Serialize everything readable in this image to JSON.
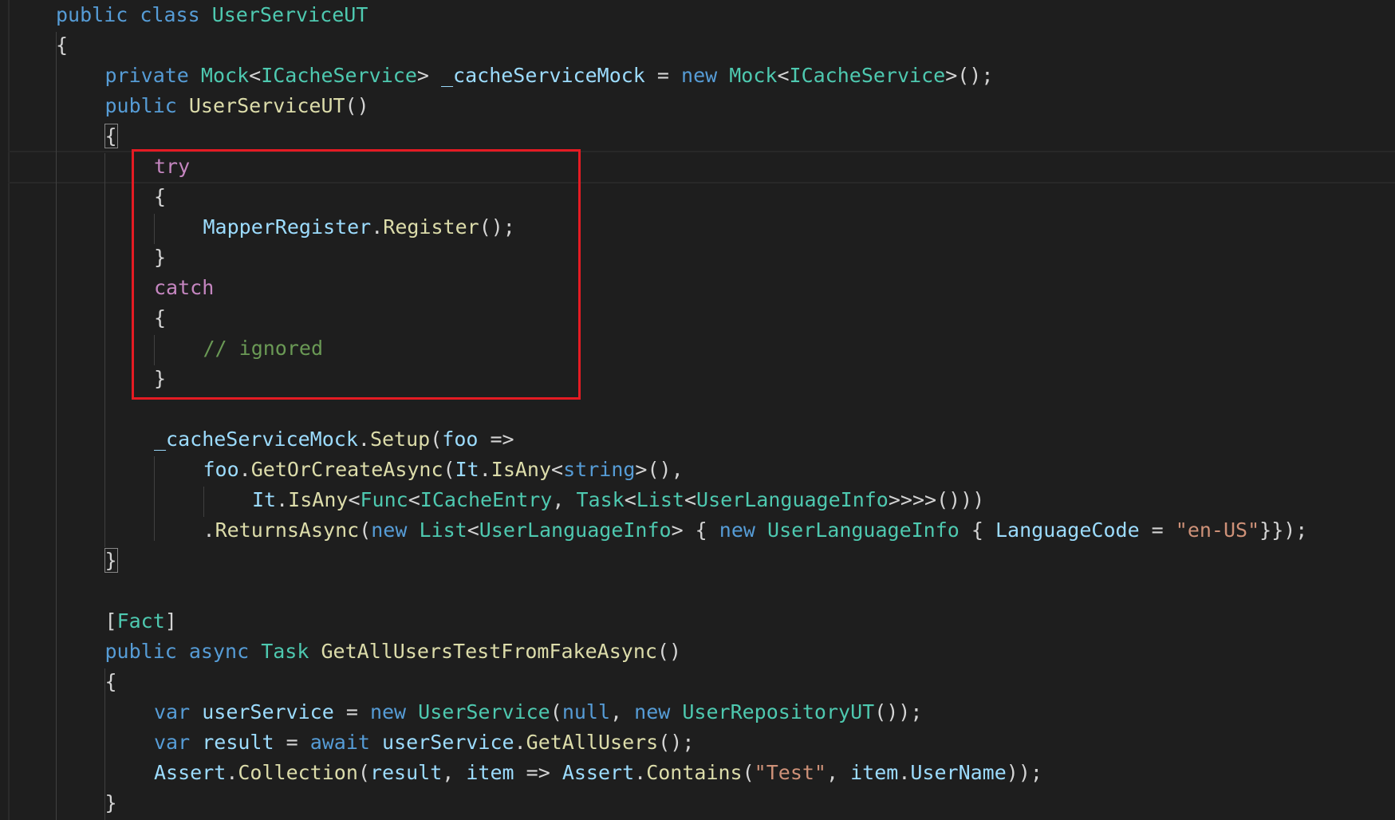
{
  "colors": {
    "background": "#1e1e1e",
    "keyword": "#569cd6",
    "control_keyword": "#c586c0",
    "type": "#4ec9b0",
    "method": "#dcdcaa",
    "identifier": "#9cdcfe",
    "string": "#ce9178",
    "comment": "#6a9955",
    "punctuation": "#d4d4d4",
    "highlight_box": "#e51b23"
  },
  "lines": [
    {
      "indent": 0,
      "tokens": [
        {
          "t": "public",
          "c": "kw"
        },
        {
          "t": " "
        },
        {
          "t": "class",
          "c": "kw"
        },
        {
          "t": " "
        },
        {
          "t": "UserServiceUT",
          "c": "type"
        }
      ]
    },
    {
      "indent": 0,
      "tokens": [
        {
          "t": "{"
        }
      ]
    },
    {
      "indent": 1,
      "tokens": [
        {
          "t": "private",
          "c": "kw"
        },
        {
          "t": " "
        },
        {
          "t": "Mock",
          "c": "type"
        },
        {
          "t": "<"
        },
        {
          "t": "ICacheService",
          "c": "type"
        },
        {
          "t": "> "
        },
        {
          "t": "_cacheServiceMock",
          "c": "id"
        },
        {
          "t": " = "
        },
        {
          "t": "new",
          "c": "kw"
        },
        {
          "t": " "
        },
        {
          "t": "Mock",
          "c": "type"
        },
        {
          "t": "<"
        },
        {
          "t": "ICacheService",
          "c": "type"
        },
        {
          "t": ">();"
        }
      ]
    },
    {
      "indent": 1,
      "tokens": [
        {
          "t": "public",
          "c": "kw"
        },
        {
          "t": " "
        },
        {
          "t": "UserServiceUT",
          "c": "fn"
        },
        {
          "t": "()"
        }
      ]
    },
    {
      "indent": 1,
      "tokens": [
        {
          "t": "{",
          "c": "bm"
        }
      ]
    },
    {
      "indent": 2,
      "tokens": [
        {
          "t": "try",
          "c": "ctl"
        }
      ]
    },
    {
      "indent": 2,
      "tokens": [
        {
          "t": "{"
        }
      ]
    },
    {
      "indent": 3,
      "tokens": [
        {
          "t": "MapperRegister",
          "c": "id"
        },
        {
          "t": "."
        },
        {
          "t": "Register",
          "c": "fn"
        },
        {
          "t": "();"
        }
      ]
    },
    {
      "indent": 2,
      "tokens": [
        {
          "t": "}"
        }
      ]
    },
    {
      "indent": 2,
      "tokens": [
        {
          "t": "catch",
          "c": "ctl"
        }
      ]
    },
    {
      "indent": 2,
      "tokens": [
        {
          "t": "{"
        }
      ]
    },
    {
      "indent": 3,
      "tokens": [
        {
          "t": "// ignored",
          "c": "cmt"
        }
      ]
    },
    {
      "indent": 2,
      "tokens": [
        {
          "t": "}"
        }
      ]
    },
    {
      "indent": 0,
      "tokens": []
    },
    {
      "indent": 2,
      "tokens": [
        {
          "t": "_cacheServiceMock",
          "c": "id"
        },
        {
          "t": "."
        },
        {
          "t": "Setup",
          "c": "fn"
        },
        {
          "t": "("
        },
        {
          "t": "foo",
          "c": "id"
        },
        {
          "t": " =>"
        }
      ]
    },
    {
      "indent": 3,
      "tokens": [
        {
          "t": "foo",
          "c": "id"
        },
        {
          "t": "."
        },
        {
          "t": "GetOrCreateAsync",
          "c": "fn"
        },
        {
          "t": "("
        },
        {
          "t": "It",
          "c": "id"
        },
        {
          "t": "."
        },
        {
          "t": "IsAny",
          "c": "fn"
        },
        {
          "t": "<"
        },
        {
          "t": "string",
          "c": "kw"
        },
        {
          "t": ">(),"
        }
      ]
    },
    {
      "indent": 4,
      "tokens": [
        {
          "t": "It",
          "c": "id"
        },
        {
          "t": "."
        },
        {
          "t": "IsAny",
          "c": "fn"
        },
        {
          "t": "<"
        },
        {
          "t": "Func",
          "c": "type"
        },
        {
          "t": "<"
        },
        {
          "t": "ICacheEntry",
          "c": "type"
        },
        {
          "t": ", "
        },
        {
          "t": "Task",
          "c": "type"
        },
        {
          "t": "<"
        },
        {
          "t": "List",
          "c": "type"
        },
        {
          "t": "<"
        },
        {
          "t": "UserLanguageInfo",
          "c": "type"
        },
        {
          "t": ">>>>()))"
        }
      ]
    },
    {
      "indent": 3,
      "tokens": [
        {
          "t": "."
        },
        {
          "t": "ReturnsAsync",
          "c": "fn"
        },
        {
          "t": "("
        },
        {
          "t": "new",
          "c": "kw"
        },
        {
          "t": " "
        },
        {
          "t": "List",
          "c": "type"
        },
        {
          "t": "<"
        },
        {
          "t": "UserLanguageInfo",
          "c": "type"
        },
        {
          "t": "> { "
        },
        {
          "t": "new",
          "c": "kw"
        },
        {
          "t": " "
        },
        {
          "t": "UserLanguageInfo",
          "c": "type"
        },
        {
          "t": " { "
        },
        {
          "t": "LanguageCode",
          "c": "id"
        },
        {
          "t": " = "
        },
        {
          "t": "\"en-US\"",
          "c": "str"
        },
        {
          "t": "}});"
        }
      ]
    },
    {
      "indent": 1,
      "tokens": [
        {
          "t": "}",
          "c": "bm"
        }
      ]
    },
    {
      "indent": 0,
      "tokens": []
    },
    {
      "indent": 1,
      "tokens": [
        {
          "t": "["
        },
        {
          "t": "Fact",
          "c": "type"
        },
        {
          "t": "]"
        }
      ]
    },
    {
      "indent": 1,
      "tokens": [
        {
          "t": "public",
          "c": "kw"
        },
        {
          "t": " "
        },
        {
          "t": "async",
          "c": "kw"
        },
        {
          "t": " "
        },
        {
          "t": "Task",
          "c": "type"
        },
        {
          "t": " "
        },
        {
          "t": "GetAllUsersTestFromFakeAsync",
          "c": "fn"
        },
        {
          "t": "()"
        }
      ]
    },
    {
      "indent": 1,
      "tokens": [
        {
          "t": "{"
        }
      ]
    },
    {
      "indent": 2,
      "tokens": [
        {
          "t": "var",
          "c": "kw"
        },
        {
          "t": " "
        },
        {
          "t": "userService",
          "c": "id"
        },
        {
          "t": " = "
        },
        {
          "t": "new",
          "c": "kw"
        },
        {
          "t": " "
        },
        {
          "t": "UserService",
          "c": "type"
        },
        {
          "t": "("
        },
        {
          "t": "null",
          "c": "kw"
        },
        {
          "t": ", "
        },
        {
          "t": "new",
          "c": "kw"
        },
        {
          "t": " "
        },
        {
          "t": "UserRepositoryUT",
          "c": "type"
        },
        {
          "t": "());"
        }
      ]
    },
    {
      "indent": 2,
      "tokens": [
        {
          "t": "var",
          "c": "kw"
        },
        {
          "t": " "
        },
        {
          "t": "result",
          "c": "id"
        },
        {
          "t": " = "
        },
        {
          "t": "await",
          "c": "kw"
        },
        {
          "t": " "
        },
        {
          "t": "userService",
          "c": "id"
        },
        {
          "t": "."
        },
        {
          "t": "GetAllUsers",
          "c": "fn"
        },
        {
          "t": "();"
        }
      ]
    },
    {
      "indent": 2,
      "tokens": [
        {
          "t": "Assert",
          "c": "id"
        },
        {
          "t": "."
        },
        {
          "t": "Collection",
          "c": "fn"
        },
        {
          "t": "("
        },
        {
          "t": "result",
          "c": "id"
        },
        {
          "t": ", "
        },
        {
          "t": "item",
          "c": "id"
        },
        {
          "t": " => "
        },
        {
          "t": "Assert",
          "c": "id"
        },
        {
          "t": "."
        },
        {
          "t": "Contains",
          "c": "fn"
        },
        {
          "t": "("
        },
        {
          "t": "\"Test\"",
          "c": "str"
        },
        {
          "t": ", "
        },
        {
          "t": "item",
          "c": "id"
        },
        {
          "t": "."
        },
        {
          "t": "UserName",
          "c": "id"
        },
        {
          "t": "));"
        }
      ]
    },
    {
      "indent": 1,
      "tokens": [
        {
          "t": "}"
        }
      ]
    }
  ]
}
